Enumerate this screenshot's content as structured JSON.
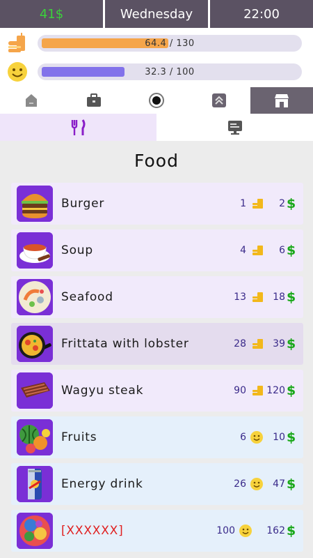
{
  "header": {
    "money": "41$",
    "day": "Wednesday",
    "time": "22:00"
  },
  "stats": {
    "food": {
      "text": "64.4 / 130",
      "fraction": 0.495,
      "icon": "burger-drink-icon",
      "color": "#f5a54a"
    },
    "mood": {
      "text": "32.3 / 100",
      "fraction": 0.323,
      "icon": "smiley-icon",
      "color": "#8272ea"
    }
  },
  "nav_tabs": [
    {
      "icon": "home-icon"
    },
    {
      "icon": "briefcase-icon"
    },
    {
      "icon": "record-icon"
    },
    {
      "icon": "chevrons-up-icon"
    },
    {
      "icon": "shop-icon",
      "active": true
    }
  ],
  "sub_tabs": [
    {
      "icon": "fork-knife-icon",
      "active": true
    },
    {
      "icon": "computer-icon"
    }
  ],
  "section_title": "Food",
  "items": [
    {
      "name": "Burger",
      "gain": "1",
      "gain_icon": "food-icon",
      "price": "2",
      "currency": "$"
    },
    {
      "name": "Soup",
      "gain": "4",
      "gain_icon": "food-icon",
      "price": "6",
      "currency": "$"
    },
    {
      "name": "Seafood",
      "gain": "13",
      "gain_icon": "food-icon",
      "price": "18",
      "currency": "$"
    },
    {
      "name": "Frittata with lobster",
      "gain": "28",
      "gain_icon": "food-icon",
      "price": "39",
      "currency": "$"
    },
    {
      "name": "Wagyu steak",
      "gain": "90",
      "gain_icon": "food-icon",
      "price": "120",
      "currency": "$"
    },
    {
      "name": "Fruits",
      "gain": "6",
      "gain_icon": "smiley-icon",
      "price": "10",
      "currency": "$"
    },
    {
      "name": "Energy drink",
      "gain": "26",
      "gain_icon": "smiley-icon",
      "price": "47",
      "currency": "$"
    },
    {
      "name": "[XXXXXX]",
      "gain": "100",
      "gain_icon": "smiley-icon",
      "price": "162",
      "currency": "$"
    }
  ]
}
